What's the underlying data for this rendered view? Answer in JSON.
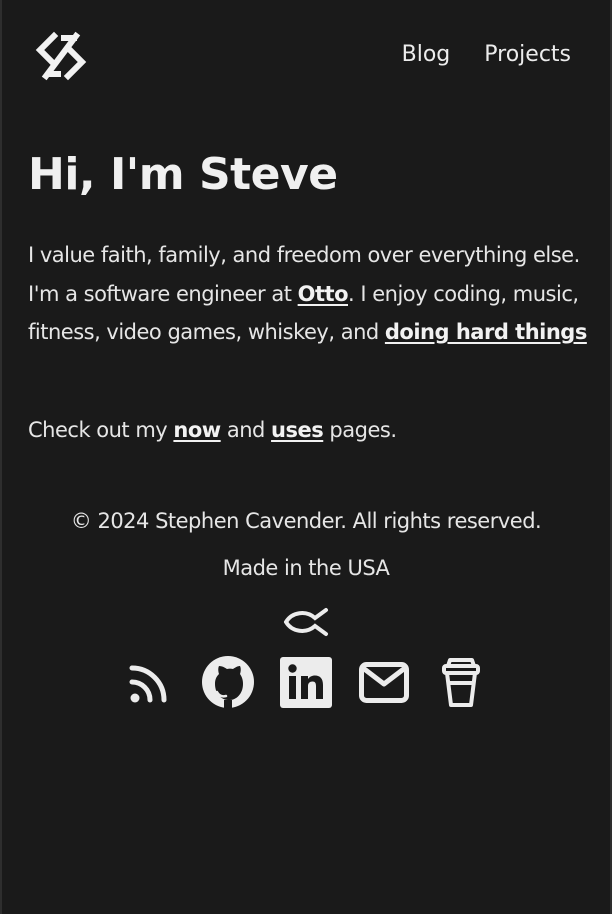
{
  "nav": {
    "links": [
      {
        "label": "Blog"
      },
      {
        "label": "Projects"
      }
    ]
  },
  "main": {
    "title": "Hi, I'm Steve",
    "intro": {
      "part1": "I value faith, family, and freedom over everything else. I'm a software engineer at ",
      "link_otto": "Otto",
      "part2": ". I enjoy coding, music, fitness, video games, whiskey, and ",
      "link_hard": "doing hard things"
    },
    "more": {
      "part1": "Check out my ",
      "link_now": "now",
      "part2": " and ",
      "link_uses": "uses",
      "part3": " pages."
    }
  },
  "footer": {
    "copyright": "© 2024 Stephen Cavender. All rights reserved.",
    "made_in": "Made in the USA",
    "social_icons": [
      "rss-icon",
      "github-icon",
      "linkedin-icon",
      "mail-icon",
      "coffee-cup-icon"
    ],
    "emblem_icon": "ichthys-fish-icon"
  },
  "colors": {
    "background": "#1a1a1a",
    "text": "#ececec"
  }
}
